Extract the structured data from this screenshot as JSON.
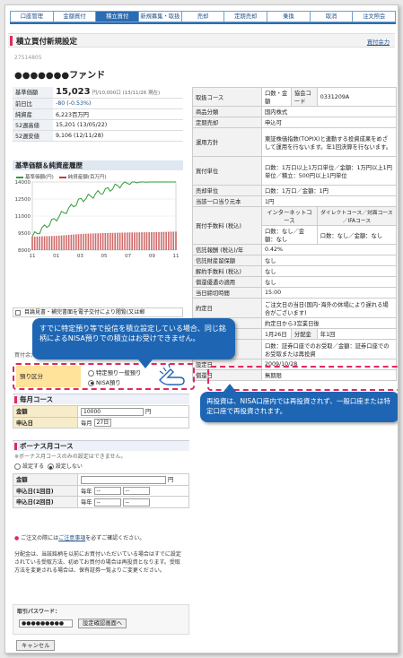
{
  "tabs": [
    "口座管理",
    "金額買付",
    "積立買付",
    "新規募集・取扱",
    "売却",
    "定期売却",
    "乗換",
    "取消",
    "注文照会"
  ],
  "page": {
    "title": "積立買付新規設定",
    "link": "買付余力"
  },
  "fund": {
    "code": "27514805",
    "name": "●●●●●●●ファンド"
  },
  "prices": [
    {
      "label": "基準価額",
      "value": "15,023",
      "unit": "円/10,000口 (13/11/26 現在)"
    },
    {
      "label": "前日比",
      "value": "-80 (-0.53%)"
    },
    {
      "label": "純資産",
      "value": "6,223百万円"
    },
    {
      "label": "52週高値",
      "value": "15,201 (13/05/22)"
    },
    {
      "label": "52週安値",
      "value": "9,106 (12/11/28)"
    }
  ],
  "chart": {
    "title": "基準価額＆純資産履歴",
    "legend_nav": "基準価額(円)",
    "legend_aum": "純資産額(百万円)",
    "y_ticks": [
      "14000",
      "12500",
      "11000",
      "9500",
      "8000"
    ],
    "x_ticks": [
      "11",
      "01",
      "03",
      "05",
      "07",
      "09",
      "11"
    ]
  },
  "chart_data": {
    "type": "line",
    "title": "基準価額＆純資産履歴",
    "x": [
      "11",
      "01",
      "03",
      "05",
      "07",
      "09",
      "11"
    ],
    "series": [
      {
        "name": "基準価額(円)",
        "values": [
          9200,
          10800,
          12400,
          13200,
          14000,
          14300,
          15000
        ]
      },
      {
        "name": "純資産額(百万円)",
        "values": [
          4500,
          4800,
          5400,
          5700,
          5900,
          6000,
          6223
        ]
      }
    ]
  },
  "info": [
    {
      "label": "取扱コース",
      "value": "口数・金額",
      "extra_label": "協会コード",
      "extra_value": "0331209A"
    },
    {
      "label": "商品分類",
      "value": "国内株式"
    },
    {
      "label": "定期売却",
      "value": "申込可"
    },
    {
      "label": "運用方針",
      "value": "東証株価指数(TOPIX)と連動する投資成果をめざして運用を行ないます。年1回決算を行ないます。"
    },
    {
      "label": "買付単位",
      "value": "口数：1万口以上1万口単位／金額：1万円以上1円単位／積立：500円以上1円単位"
    },
    {
      "label": "売却単位",
      "value": "口数：1万口／金額：1円"
    },
    {
      "label": "当該一口当り元本",
      "value": "1円"
    },
    {
      "label": "買付手数料 (税込)",
      "head1": "インターネットコース",
      "head2": "ダイレクトコース／対面コース／IFAコース",
      "v1": "口数：なし／金額：なし",
      "v2": "口数：なし／金額：なし"
    },
    {
      "label": "信託報酬 (税込)/年",
      "value": "0.42%"
    },
    {
      "label": "信託財産留保額",
      "value": "なし"
    },
    {
      "label": "解約手数料 (税込)",
      "value": "なし"
    },
    {
      "label": "償還優遇の適用",
      "value": "なし"
    },
    {
      "label": "当日締切時間",
      "value": "15:00"
    },
    {
      "label": "約定日",
      "value": "ご注文日の当日(国内･海外の休場により遅れる場合がございます)"
    },
    {
      "label": "受渡日",
      "value": "約定日から3営業日後"
    },
    {
      "label": "決算日",
      "value": "1月26日",
      "extra_label": "分配金",
      "extra_value": "年1回"
    },
    {
      "label": "分配金受取方法",
      "value": "口数：証券口座でのお受取／金額：証券口座でのお受取または再投資"
    },
    {
      "label": "設定日",
      "value": "2009/10/28"
    },
    {
      "label": "償還日",
      "value": "無期限"
    }
  ],
  "checkbox_label": "目論見書・補完書面を電子交付により閲覧(又は郵",
  "bubble1": "すでに特定預り等で投信を積立設定している場合、同じ銘柄によるNISA預りでの積立はお受けできません。",
  "bubble2": "再投資は、NISA口座内では再投資されず、一般口座または特定口座で再投資されます。",
  "account": {
    "label": "預り区分",
    "opt1": "特定預り一般預り",
    "opt2": "NISA預り",
    "hint": "買付余力(税込)"
  },
  "monthly": {
    "title": "毎月コース",
    "amount_label": "金額",
    "amount_value": "10000",
    "unit": "円",
    "date_label": "申込日",
    "date_prefix": "毎月",
    "date_value": "27日"
  },
  "bonus": {
    "title": "ボーナス月コース",
    "note": "※ボーナス月コースのみの設定はできません。",
    "opt_yes": "設定する",
    "opt_no": "設定しない",
    "amount_label": "金額",
    "unit": "円",
    "d1_label": "申込日(1回目)",
    "d2_label": "申込日(2回目)",
    "prefix": "毎年",
    "dash": "--"
  },
  "notice": {
    "text_before": "ご注文の際には",
    "link": "ご注意事項",
    "text_after": "を必ずご確認ください。"
  },
  "dist_note": "分配金は、当該銘柄を以前にお買付いただいている場合はすでに設定されている受取方法、初めてお買付の場合は再投資となります。受取方法を変更される場合は、保有証券一覧よりご変更ください。",
  "password": {
    "label": "取引パスワード：",
    "value": "●●●●●●●●●",
    "confirm": "設定確認画面へ"
  },
  "cancel": "キャンセル"
}
